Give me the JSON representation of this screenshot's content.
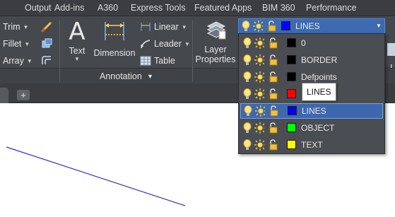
{
  "menu": {
    "tabs": [
      {
        "label": "Output"
      },
      {
        "label": "Add-ins"
      },
      {
        "label": "A360"
      },
      {
        "label": "Express Tools"
      },
      {
        "label": "Featured Apps"
      },
      {
        "label": "BIM 360"
      },
      {
        "label": "Performance"
      }
    ]
  },
  "ribbon": {
    "modify": {
      "trim": "Trim",
      "fillet": "Fillet",
      "array": "Array"
    },
    "annotation": {
      "text": "Text",
      "dimension": "Dimension",
      "linear": "Linear",
      "leader": "Leader",
      "table": "Table",
      "panel_title": "Annotation"
    },
    "layers": {
      "layer_properties_line1": "Layer",
      "layer_properties_line2": "Properties"
    },
    "right_cut_label": "I"
  },
  "layer_combo": {
    "current": "LINES",
    "color": "#0000ff"
  },
  "layers": [
    {
      "name": "0",
      "color": "#000000"
    },
    {
      "name": "BORDER",
      "color": "#000000"
    },
    {
      "name": "Defpoints",
      "color": "#000000"
    },
    {
      "name": "",
      "color": "#ff0000"
    },
    {
      "name": "LINES",
      "color": "#0000ff",
      "selected": true
    },
    {
      "name": "OBJECT",
      "color": "#00ff00"
    },
    {
      "name": "TEXT",
      "color": "#ffff00"
    }
  ],
  "tooltip": {
    "text": "LINES"
  },
  "colors": {
    "accent": "#3e68ae",
    "ribbon": "#45484d",
    "menubar": "#3b3d41",
    "drawn_line": "#3333dd"
  }
}
